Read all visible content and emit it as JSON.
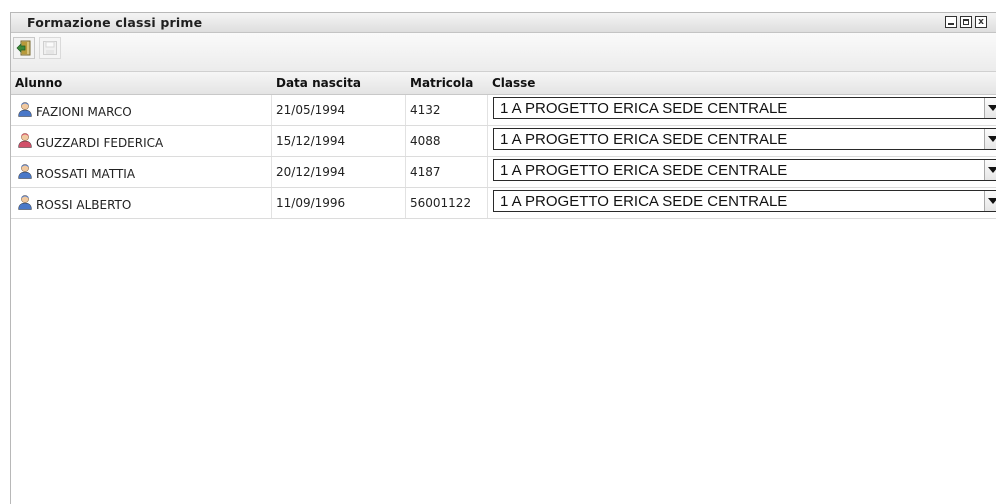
{
  "window": {
    "title": "Formazione classi prime"
  },
  "toolbar": {
    "buttons": [
      {
        "name": "exit",
        "icon": "exit-door-icon",
        "enabled": true
      },
      {
        "name": "save",
        "icon": "save-icon",
        "enabled": false
      }
    ]
  },
  "grid": {
    "columns": [
      "Alunno",
      "Data nascita",
      "Matricola",
      "Classe"
    ],
    "rows": [
      {
        "alunno": "FAZIONI MARCO",
        "gender": "male",
        "data": "21/05/1994",
        "matricola": "4132",
        "classe": "1 A PROGETTO ERICA SEDE CENTRALE"
      },
      {
        "alunno": "GUZZARDI FEDERICA",
        "gender": "female",
        "data": "15/12/1994",
        "matricola": "4088",
        "classe": "1 A PROGETTO ERICA SEDE CENTRALE"
      },
      {
        "alunno": "ROSSATI MATTIA",
        "gender": "male",
        "data": "20/12/1994",
        "matricola": "4187",
        "classe": "1 A PROGETTO ERICA SEDE CENTRALE"
      },
      {
        "alunno": "ROSSI ALBERTO",
        "gender": "male",
        "data": "11/09/1996",
        "matricola": "56001122",
        "classe": "1 A PROGETTO ERICA SEDE CENTRALE"
      }
    ]
  },
  "colors": {
    "male_icon": "#4a78c8",
    "female_icon": "#d2506a",
    "exit_icon": "#3c8a3c"
  }
}
